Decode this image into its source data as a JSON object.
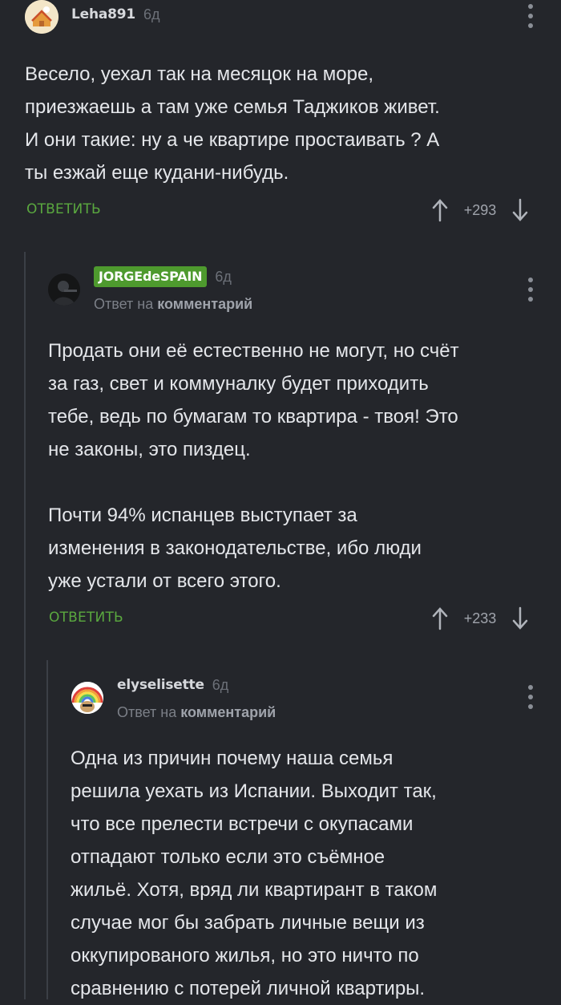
{
  "colors": {
    "background": "#24262b",
    "accent": "#5aa83f",
    "highlight_badge": "#4e9a2e"
  },
  "comments": [
    {
      "author": "Leha891",
      "age": "6д",
      "text": "Весело, уехал так на месяцок на море,\nприезжаешь а там уже семья Таджиков живет.\nИ они такие: ну а че квартире простаивать ? А\nты езжай еще кудани-нибудь.",
      "reply_label": "ОТВЕТИТЬ",
      "votes": "+293"
    },
    {
      "author": "JORGEdeSPAIN",
      "age": "6д",
      "reply_to_prefix": "Ответ на",
      "reply_to_link": "комментарий",
      "text": "Продать они её естественно не могут, но счёт\nза газ, свет и коммуналку будет приходить\nтебе, ведь по бумагам то квартира - твоя! Это\nне законы, это пиздец.\n\nПочти 94% испанцев выступает за\nизменения в законодательстве, ибо люди\nуже устали от всего этого.",
      "reply_label": "ОТВЕТИТЬ",
      "votes": "+233"
    },
    {
      "author": "elyselisette",
      "age": "6д",
      "reply_to_prefix": "Ответ на",
      "reply_to_link": "комментарий",
      "text": "Одна из причин почему наша семья\nрешила уехать из Испании. Выходит так,\nчто все прелести встречи с окупасами\nотпадают только если это съёмное\nжильё. Хотя, вряд ли квартирант в таком\nслучае мог бы забрать личные вещи из\nоккупированого жилья, но это ничто по\nсравнению с потерей личной квартиры."
    }
  ],
  "icons": {
    "upvote": "arrow-up-icon",
    "downvote": "arrow-down-icon",
    "menu": "more-vertical-icon"
  }
}
